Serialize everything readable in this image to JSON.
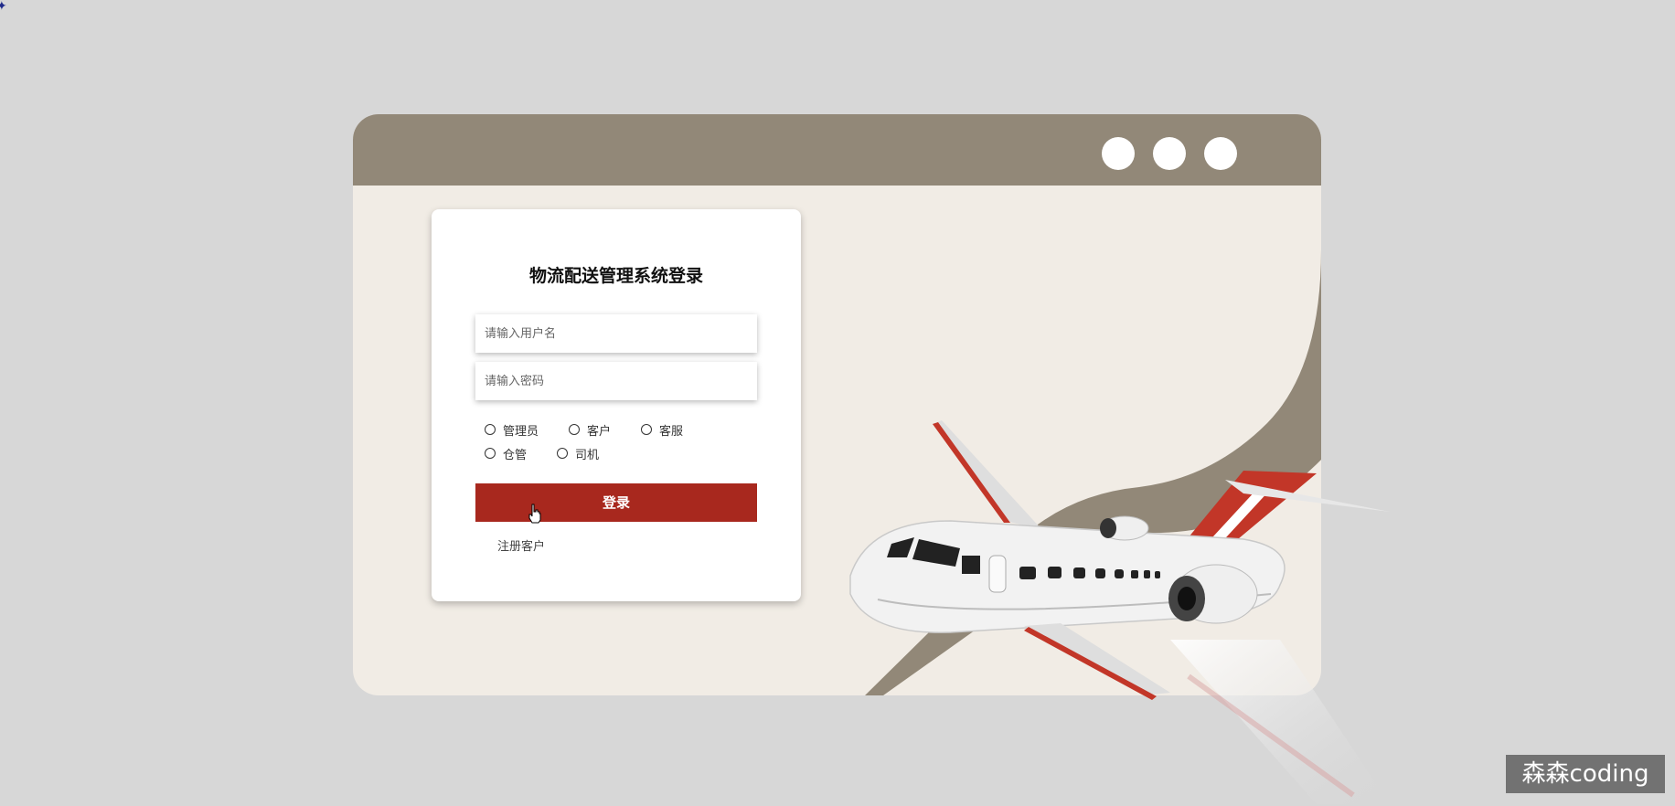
{
  "page": {
    "title": "物流配送管理系统登录"
  },
  "colors": {
    "background": "#d7d7d7",
    "titlebar": "#928878",
    "window_body": "#f1ece5",
    "accent_red": "#a8281e"
  },
  "login": {
    "username_placeholder": "请输入用户名",
    "password_placeholder": "请输入密码",
    "roles": [
      {
        "label": "管理员",
        "selected": false
      },
      {
        "label": "客户",
        "selected": false
      },
      {
        "label": "客服",
        "selected": false
      },
      {
        "label": "仓管",
        "selected": false
      },
      {
        "label": "司机",
        "selected": false
      }
    ],
    "submit_label": "登录",
    "register_link": "注册客户"
  },
  "watermark": {
    "text": "森森coding"
  },
  "icons": {
    "window_controls": [
      "window-dot",
      "window-dot",
      "window-dot"
    ],
    "illustration": "airplane-illustration",
    "pointer": "hand-cursor-icon"
  }
}
